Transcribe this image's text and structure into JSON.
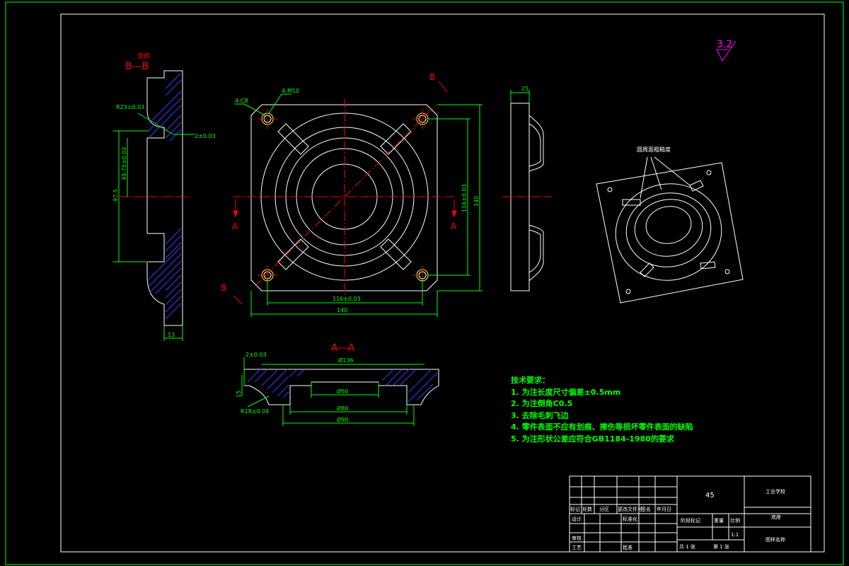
{
  "labels": {
    "section_bb": "B—B",
    "section_bb_note": "旋转",
    "section_aa": "A—A",
    "roughness": "3.2",
    "marker_a": "A",
    "marker_b": "B"
  },
  "dims": {
    "r23": "R23±0.03",
    "d2a": "2±0.03",
    "d49": "49.75±0.02",
    "d97": "97.5",
    "d13": "13",
    "d4c8": "4-C8",
    "d4m10": "4-M10",
    "d116h": "116±0.03",
    "d140h": "140",
    "d116v": "116±0.03",
    "d140v": "140",
    "d25": "25",
    "d2b": "2±0.03",
    "d136": "Ø136",
    "d15": "15",
    "d50": "Ø50",
    "d80": "Ø80",
    "d90": "Ø90",
    "r18": "R18±0.04",
    "iso_note": "圆周面粗糙度"
  },
  "tech": {
    "title": "技术要求：",
    "items": [
      "1. 为注长度尺寸偏差±0.5mm",
      "2. 为注倒角C0.5",
      "3. 去除毛刺飞边",
      "4. 零件表面不应有划痕、擦伤等损坏零件表面的缺陷",
      "5. 为注形状公差应符合GB1184-1980的要求"
    ]
  },
  "titleblock": {
    "material": "45",
    "school": "工业学校",
    "part": "底座",
    "scale": "1:1",
    "sheets": "共 1 张",
    "sheet": "第 1 张",
    "drawing_no": "图样名称",
    "h_mark": "标记",
    "h_count": "处数",
    "h_zone": "分区",
    "h_doc": "更改文件号",
    "h_sign": "签名",
    "h_date": "年月日",
    "design": "设计",
    "std": "标准化",
    "check": "审核",
    "craft": "工艺",
    "approve": "批准",
    "stage": "阶段标记",
    "weight": "重量",
    "ratio": "比例"
  }
}
